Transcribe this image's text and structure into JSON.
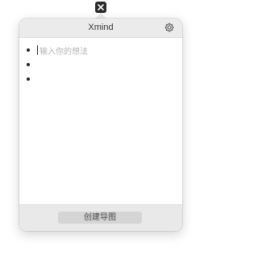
{
  "app": {
    "title": "Xmind"
  },
  "icons": {
    "menubar": "xmind-logo-icon",
    "settings": "gear-icon"
  },
  "editor": {
    "placeholder": "输入你的想法",
    "bullets": [
      "",
      "",
      ""
    ]
  },
  "footer": {
    "create_label": "创建导图"
  },
  "colors": {
    "header_bg": "#ebebeb",
    "footer_bg": "#e9e9e9",
    "button_bg": "#d5d5d5",
    "placeholder_text": "#b5b5b5"
  }
}
